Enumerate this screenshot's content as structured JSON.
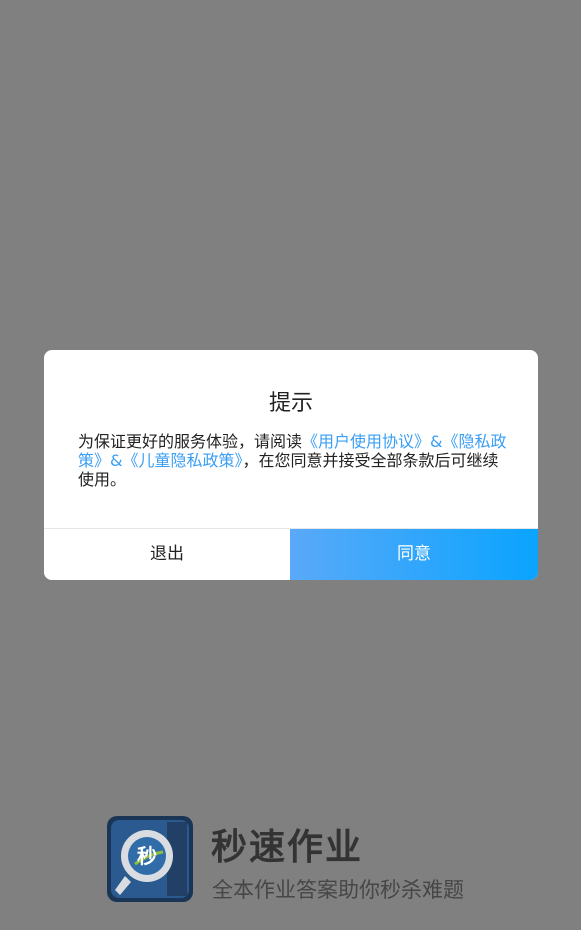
{
  "brand": {
    "name": "秒速作业",
    "slogan": "全本作业答案助你秒杀难题",
    "icon": "magnifier-logo-icon",
    "icon_text": "秒",
    "colors": {
      "icon_outer": "#1b3556",
      "icon_inner": "#2b5a91",
      "icon_center": "#2f6ca8"
    }
  },
  "dialog": {
    "title": "提示",
    "body_prefix": "为保证更好的服务体验，请阅读",
    "link_user_agreement": "《用户使用协议》",
    "amp_1": "&",
    "link_privacy_policy": "《隐私政策》",
    "amp_2": "&",
    "link_child_privacy": "《儿童隐私政策》",
    "body_suffix": "，在您同意并接受全部条款后可继续使用。",
    "exit_label": "退出",
    "agree_label": "同意"
  },
  "colors": {
    "overlay": "#808080",
    "link": "#3a9ef5",
    "agree_gradient_start": "#5aa9f8",
    "agree_gradient_end": "#0aa4ff"
  }
}
